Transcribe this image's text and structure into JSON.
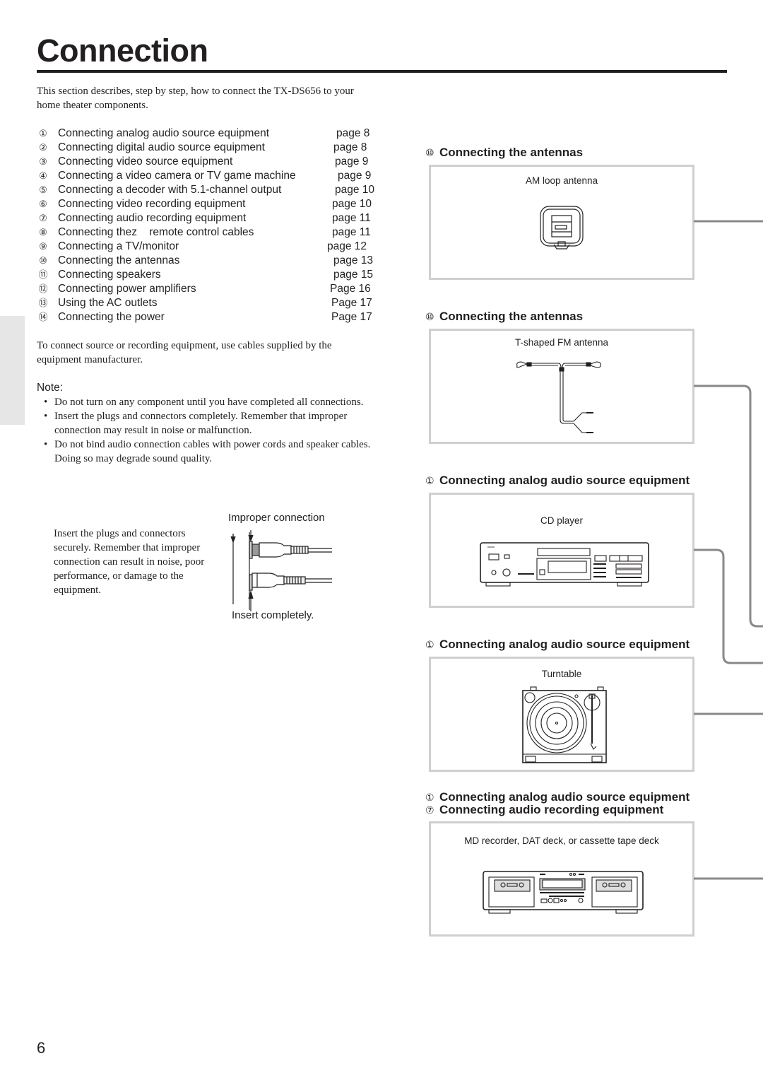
{
  "page": {
    "title": "Connection",
    "intro": "This section describes, step by step, how to connect the TX-DS656 to your home theater components.",
    "page_number": "6"
  },
  "toc": [
    {
      "num": "①",
      "label": "Connecting analog audio source equipment",
      "page": "page 8"
    },
    {
      "num": "②",
      "label": "Connecting digital audio source equipment",
      "page": "page 8"
    },
    {
      "num": "③",
      "label": "Connecting video source equipment",
      "page": "page 9"
    },
    {
      "num": "④",
      "label": "Connecting a video camera or TV game machine",
      "page": "page 9"
    },
    {
      "num": "⑤",
      "label": "Connecting a decoder with 5.1-channel output",
      "page": "page 10"
    },
    {
      "num": "⑥",
      "label": "Connecting video recording equipment",
      "page": "page 10"
    },
    {
      "num": "⑦",
      "label": "Connecting audio recording equipment",
      "page": "page 11"
    },
    {
      "num": "⑧",
      "label": "Connecting thez    remote control cables",
      "page": "page 11"
    },
    {
      "num": "⑨",
      "label": "Connecting a TV/monitor",
      "page": "page 12"
    },
    {
      "num": "⑩",
      "label": "Connecting the antennas",
      "page": "page 13"
    },
    {
      "num": "⑪",
      "label": "Connecting speakers",
      "page": "page 15"
    },
    {
      "num": "⑫",
      "label": "Connecting power amplifiers",
      "page": "Page 16"
    },
    {
      "num": "⑬",
      "label": "Using the AC outlets",
      "page": "Page 17"
    },
    {
      "num": "⑭",
      "label": "Connecting the power",
      "page": "Page 17"
    }
  ],
  "supply_text": "To connect source or recording equipment, use cables supplied by the equipment manufacturer.",
  "note": {
    "title": "Note:",
    "bullet": "•",
    "items": [
      "Do not turn on any component until you have completed all connections.",
      "Insert the plugs and connectors completely. Remember that improper connection may result in noise or malfunction.",
      "Do not bind audio connection cables with power cords and speaker cables. Doing so may degrade sound quality."
    ]
  },
  "caution": {
    "text": "Insert the plugs and connectors securely. Remember that improper connection can result in noise, poor performance, or damage to the equipment.",
    "improper_label": "Improper connection",
    "insert_label": "Insert completely."
  },
  "sections": [
    {
      "num": "⑩",
      "heading": "Connecting the antennas",
      "caption": "AM loop antenna",
      "icon": "am-loop-antenna-icon"
    },
    {
      "num": "⑩",
      "heading": "Connecting the antennas",
      "caption": "T-shaped FM antenna",
      "icon": "fm-antenna-icon"
    },
    {
      "num": "①",
      "heading": "Connecting analog audio source equipment",
      "caption": "CD player",
      "icon": "cd-player-icon"
    },
    {
      "num": "①",
      "heading": "Connecting analog audio source equipment",
      "caption": "Turntable",
      "icon": "turntable-icon"
    },
    {
      "num": "①",
      "heading": "Connecting analog audio source equipment",
      "num2": "⑦",
      "heading2": "Connecting audio recording equipment",
      "caption": "MD recorder, DAT deck, or cassette tape deck",
      "icon": "cassette-deck-icon"
    }
  ],
  "colors": {
    "text": "#231f20",
    "panel_border": "#cfcfd0",
    "connector_line": "#888889",
    "side_tab": "#e6e6e7"
  }
}
